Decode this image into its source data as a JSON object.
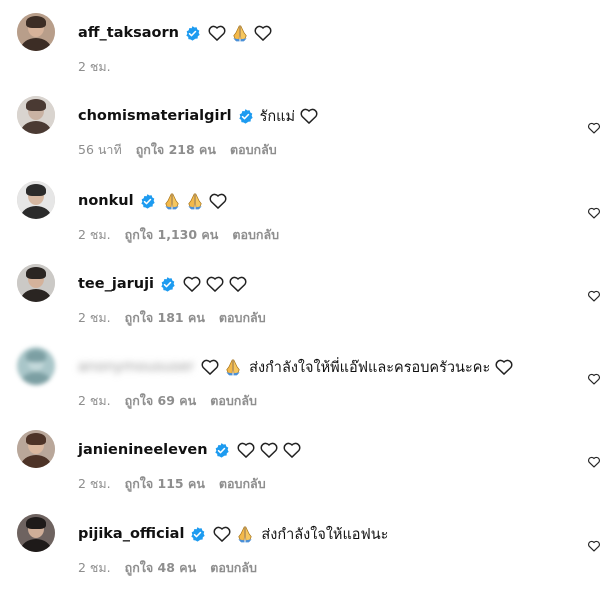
{
  "comments": [
    {
      "username": "aff_taksaorn",
      "verified": true,
      "blurred": false,
      "emojis": [
        "white-heart-icon",
        "folded-hands-icon",
        "white-heart-icon"
      ],
      "text": "",
      "trailing_emojis": [],
      "time": "2 ชม.",
      "likes": "",
      "reply": "",
      "show_like_button": false,
      "avatar_colors": [
        "#b89e8a",
        "#3c2d25",
        "#d7b39a"
      ]
    },
    {
      "username": "chomismaterialgirl",
      "verified": true,
      "blurred": false,
      "emojis": [],
      "text": "รักแม่",
      "trailing_emojis": [
        "white-heart-icon"
      ],
      "time": "56 นาที",
      "likes": "ถูกใจ 218 คน",
      "reply": "ตอบกลับ",
      "show_like_button": true,
      "avatar_colors": [
        "#d9d4cf",
        "#4a3a33",
        "#c9b2a3"
      ]
    },
    {
      "username": "nonkul",
      "verified": true,
      "blurred": false,
      "emojis": [
        "folded-hands-icon",
        "folded-hands-icon",
        "white-heart-icon"
      ],
      "text": "",
      "trailing_emojis": [],
      "time": "2 ชม.",
      "likes": "ถูกใจ 1,130 คน",
      "reply": "ตอบกลับ",
      "show_like_button": true,
      "avatar_colors": [
        "#e6e6e6",
        "#2b2b2b",
        "#d6b8a2"
      ]
    },
    {
      "username": "tee_jaruji",
      "verified": true,
      "blurred": false,
      "emojis": [
        "white-heart-icon",
        "white-heart-icon",
        "white-heart-icon"
      ],
      "text": "",
      "trailing_emojis": [],
      "time": "2 ชม.",
      "likes": "ถูกใจ 181 คน",
      "reply": "ตอบกลับ",
      "show_like_button": true,
      "avatar_colors": [
        "#cbc9c6",
        "#2a2522",
        "#d4b29b"
      ]
    },
    {
      "username": "anonymoususer",
      "verified": false,
      "blurred": true,
      "emojis": [
        "white-heart-icon",
        "folded-hands-icon"
      ],
      "text": "ส่งกำลังใจให้พี่แอ๊ฟและครอบครัวนะคะ",
      "trailing_emojis": [
        "white-heart-icon"
      ],
      "time": "2 ชม.",
      "likes": "ถูกใจ 69 คน",
      "reply": "ตอบกลับ",
      "show_like_button": true,
      "avatar_colors": [
        "#a9c6c9",
        "#7c9fa3",
        "#c3d8da"
      ]
    },
    {
      "username": "janienineeleven",
      "verified": true,
      "blurred": false,
      "emojis": [
        "white-heart-icon",
        "white-heart-icon",
        "white-heart-icon"
      ],
      "text": "",
      "trailing_emojis": [],
      "time": "2 ชม.",
      "likes": "ถูกใจ 115 คน",
      "reply": "ตอบกลับ",
      "show_like_button": true,
      "avatar_colors": [
        "#b9a79a",
        "#4d3327",
        "#d9b79e"
      ]
    },
    {
      "username": "pijika_official",
      "verified": true,
      "blurred": false,
      "emojis": [
        "white-heart-icon",
        "folded-hands-icon"
      ],
      "text": "ส่งกำลังใจให้แอฟนะ",
      "trailing_emojis": [],
      "time": "2 ชม.",
      "likes": "ถูกใจ 48 คน",
      "reply": "ตอบกลับ",
      "show_like_button": true,
      "avatar_colors": [
        "#6e6360",
        "#1e1a19",
        "#cfae98"
      ]
    }
  ],
  "colors": {
    "verified": "#1d9bf0",
    "meta_text": "#8e8e8e",
    "hands": "#f3b94b"
  }
}
